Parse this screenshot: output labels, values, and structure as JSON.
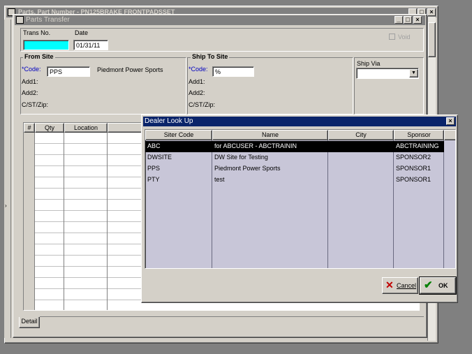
{
  "background_window": {
    "title": "Parts, Part Number - PN125BRAKE FRONTPADSSET"
  },
  "parts_transfer": {
    "title": "Parts Transfer",
    "trans_no_label": "Trans No.",
    "trans_no_value": "",
    "date_label": "Date",
    "date_value": "01/31/11",
    "void_label": "Void",
    "from_site": {
      "title": "From Site",
      "code_label": "*Code:",
      "code_value": "PPS",
      "site_name": "Piedmont Power Sports",
      "add1_label": "Add1:",
      "add2_label": "Add2:",
      "cstzip_label": "C/ST/Zip:"
    },
    "ship_to_site": {
      "title": "Ship To Site",
      "code_label": "*Code:",
      "code_value": "%",
      "add1_label": "Add1:",
      "add2_label": "Add2:",
      "cstzip_label": "C/ST/Zip:"
    },
    "ship_via_label": "Ship Via",
    "ship_via_value": "",
    "grid_headers": [
      "#",
      "Qty",
      "Location"
    ],
    "tab_detail": "Detail"
  },
  "dealer_lookup": {
    "title": "Dealer Look Up",
    "columns": [
      "Siter Code",
      "Name",
      "City",
      "Sponsor"
    ],
    "rows": [
      {
        "code": "ABC",
        "name": "for ABCUSER - ABCTRAININ",
        "city": "",
        "sponsor": "ABCTRAINING"
      },
      {
        "code": "DWSITE",
        "name": "DW Site for Testing",
        "city": "",
        "sponsor": "SPONSOR2"
      },
      {
        "code": "PPS",
        "name": "Piedmont Power Sports",
        "city": "",
        "sponsor": "SPONSOR1"
      },
      {
        "code": "PTY",
        "name": "test",
        "city": "",
        "sponsor": "SPONSOR1"
      }
    ],
    "selected_row": 0,
    "cancel_label": "Cancel",
    "ok_label": "OK"
  },
  "colors": {
    "title_active": "#0a246a",
    "title_inactive": "#808080",
    "face": "#d4d0c8",
    "trans_no_fill": "#00ffff",
    "selected_row": "#000000",
    "grid_fill": "#c8c6d8"
  }
}
